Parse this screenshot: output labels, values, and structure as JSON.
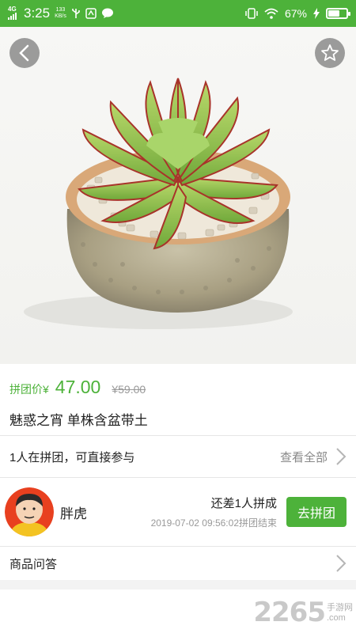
{
  "status_bar": {
    "network": "4G",
    "time": "3:25",
    "speed_value": "133",
    "speed_unit": "KB/s",
    "battery": "67%",
    "battery_level": 0.67
  },
  "product": {
    "price_label": "拼团价¥",
    "price": "47.00",
    "original_price": "¥59.00",
    "name": "魅惑之宵 单株含盆带土"
  },
  "group": {
    "status_text": "1人在拼团，可直接参与",
    "view_all_label": "查看全部"
  },
  "member": {
    "name": "胖虎",
    "remaining": "还差1人拼成",
    "deadline": "2019-07-02 09:56:02拼团结束",
    "join_label": "去拼团"
  },
  "qa": {
    "label": "商品问答"
  },
  "watermark": {
    "number": "2265",
    "suffix": ".com",
    "site": "手游网"
  },
  "colors": {
    "brand_green": "#4db23a",
    "muted_text": "#999999"
  },
  "icons": [
    "back-arrow-icon",
    "star-icon",
    "chevron-right-icon",
    "usb-icon",
    "wechat-icon",
    "vibrate-icon",
    "wifi-icon",
    "battery-icon"
  ]
}
